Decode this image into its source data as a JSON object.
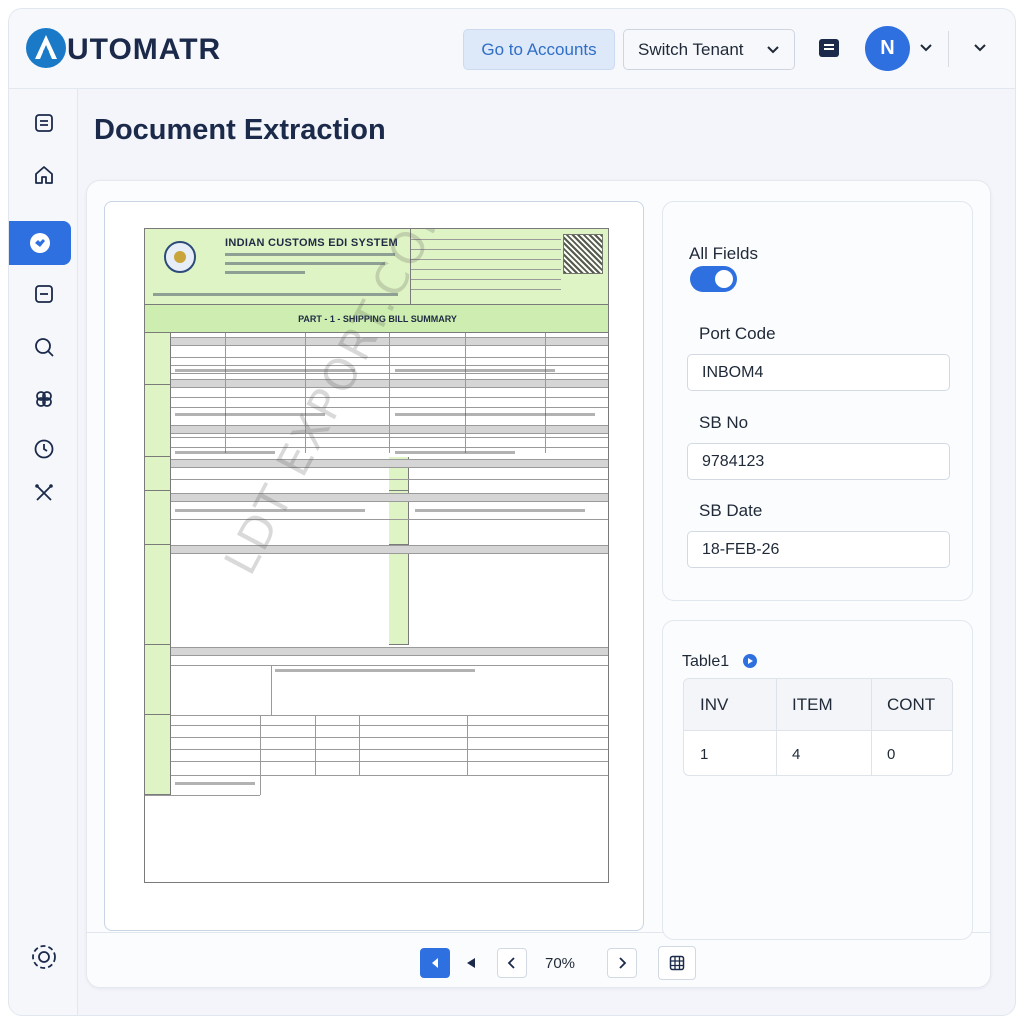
{
  "app": {
    "logo_text": "UTOMATR"
  },
  "header": {
    "accounts_button": "Go to Accounts",
    "tenant_button": "Switch Tenant",
    "avatar_initial": "N"
  },
  "sidebar": {
    "items": [
      {
        "icon": "document-icon",
        "active": false
      },
      {
        "icon": "home-icon",
        "active": false
      },
      {
        "icon": "extraction-icon",
        "active": true
      },
      {
        "icon": "minus-box-icon",
        "active": false
      },
      {
        "icon": "search-icon",
        "active": false
      },
      {
        "icon": "integrations-icon",
        "active": false
      },
      {
        "icon": "history-icon",
        "active": false
      },
      {
        "icon": "tools-icon",
        "active": false
      }
    ],
    "footer_icon": "settings-icon"
  },
  "page": {
    "title": "Document Extraction"
  },
  "document": {
    "header_title": "INDIAN  CUSTOMS EDI SYSTEM",
    "part_title": "PART - 1 - SHIPPING BILL SUMMARY",
    "watermark": "LDT EXPORT.COM"
  },
  "viewer": {
    "zoom": "70%"
  },
  "fields": {
    "all_fields_label": "All Fields",
    "all_fields_enabled": true,
    "items": [
      {
        "label": "Port Code",
        "value": "INBOM4"
      },
      {
        "label": "SB No",
        "value": "9784123"
      },
      {
        "label": "SB Date",
        "value": "18-FEB-26"
      }
    ]
  },
  "table": {
    "title": "Table1",
    "headers": [
      "INV",
      "ITEM",
      "CONT"
    ],
    "rows": [
      [
        "1",
        "4",
        "0"
      ]
    ]
  },
  "colors": {
    "accent": "#2e70e0",
    "brand_dark": "#1b2a4a",
    "doc_green": "#dff4c5"
  }
}
